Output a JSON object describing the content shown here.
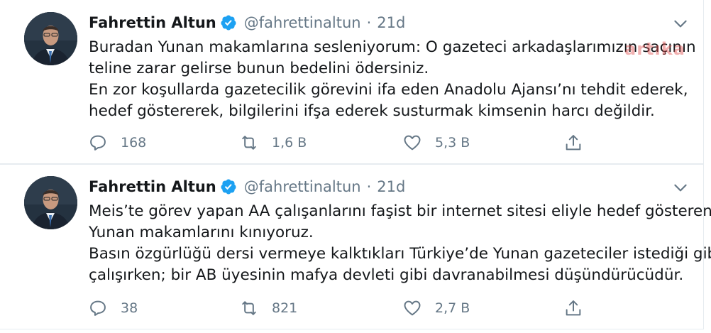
{
  "tweets": [
    {
      "author_name": "Fahrettin Altun",
      "handle": "@fahrettinaltun",
      "separator": "·",
      "time": "21d",
      "lines": [
        "Buradan Yunan makamlarına sesleniyorum: O gazeteci arkadaşlarımızın saçının",
        "teline zarar gelirse bunun bedelini ödersiniz.",
        "En zor koşullarda gazetecilik görevini ifa eden Anadolu Ajansı’nı tehdit ederek,",
        "hedef göstererek, bilgilerini ifşa ederek susturmak kimsenin harcı değildir."
      ],
      "replies": "168",
      "retweets": "1,6 B",
      "likes": "5,3 B"
    },
    {
      "author_name": "Fahrettin Altun",
      "handle": "@fahrettinaltun",
      "separator": "·",
      "time": "21d",
      "lines": [
        "Meis’te görev yapan AA çalışanlarını faşist bir internet sitesi eliyle hedef gösteren",
        "Yunan makamlarını kınıyoruz.",
        "Basın özgürlüğü dersi vermeye kalktıkları Türkiye’de Yunan gazeteciler istediği gibi",
        "çalışırken; bir AB üyesinin mafya devleti gibi davranabilmesi düşündürücüdür."
      ],
      "replies": "38",
      "retweets": "821",
      "likes": "2,7 B"
    }
  ],
  "watermark": "artıka",
  "icons": {
    "verified": "verified-badge-icon",
    "chevron": "chevron-down-icon",
    "reply": "reply-icon",
    "retweet": "retweet-icon",
    "like": "heart-icon",
    "share": "share-icon"
  },
  "colors": {
    "text": "#14171a",
    "secondary": "#657786",
    "verified": "#1da1f2",
    "border": "#e6ecf0"
  }
}
